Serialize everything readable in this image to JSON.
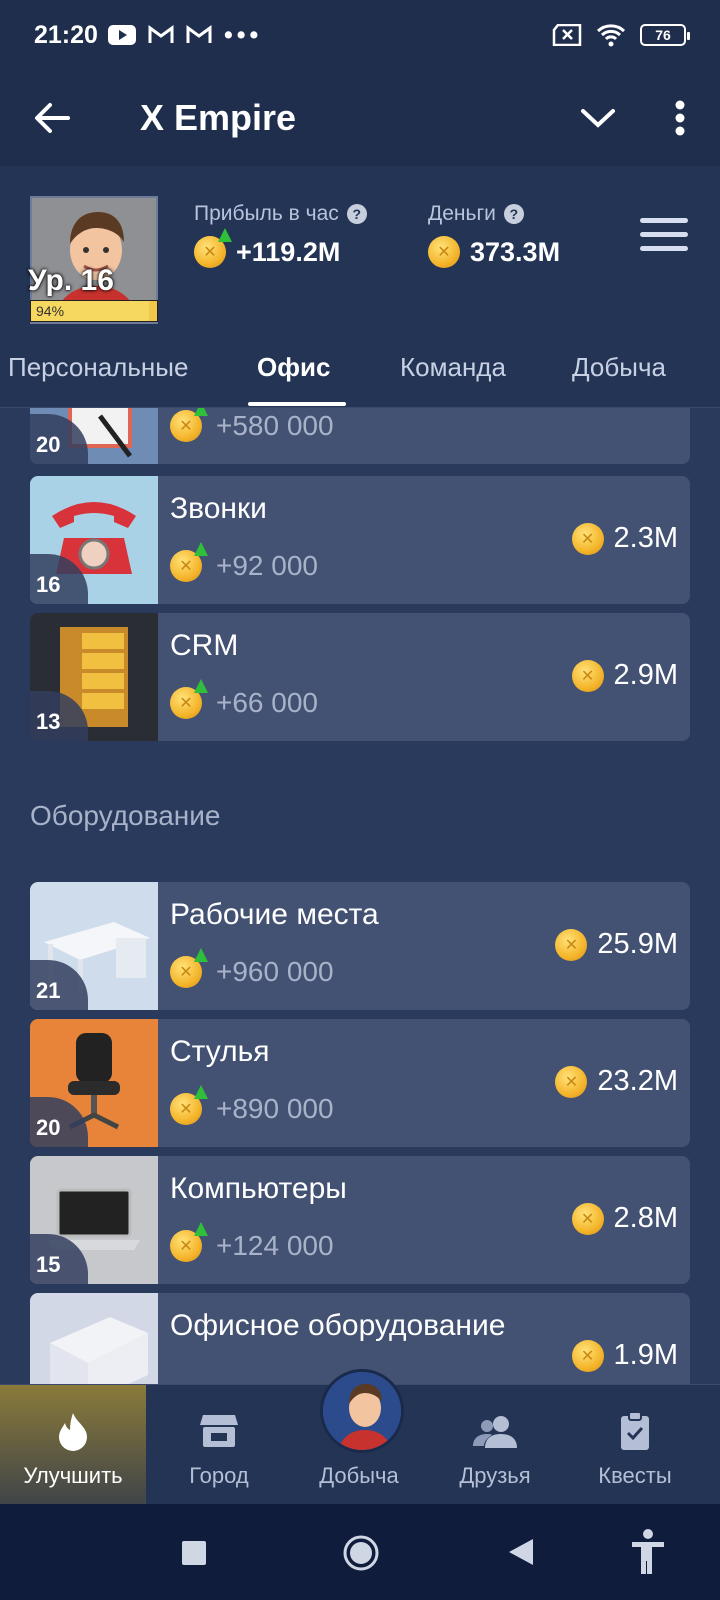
{
  "status_bar": {
    "time": "21:20",
    "battery": "76"
  },
  "app_bar": {
    "title": "X Empire"
  },
  "profile": {
    "level_label": "Ур. 16",
    "level_progress_label": "94%",
    "level_progress": 0.94,
    "profit_label": "Прибыль в час",
    "profit_value": "+119.2M",
    "money_label": "Деньги",
    "money_value": "373.3M",
    "help_glyph": "?"
  },
  "tabs": [
    {
      "label": "Персональные"
    },
    {
      "label": "Офис"
    },
    {
      "label": "Команда"
    },
    {
      "label": "Добыча"
    }
  ],
  "partial_top_card": {
    "level": "20",
    "profit": "+580 000"
  },
  "cards_group1": [
    {
      "name": "Звонки",
      "level": "16",
      "profit": "+92 000",
      "price": "2.3M"
    },
    {
      "name": "CRM",
      "level": "13",
      "profit": "+66 000",
      "price": "2.9M"
    }
  ],
  "section_equipment": "Оборудование",
  "cards_group2": [
    {
      "name": "Рабочие места",
      "level": "21",
      "profit": "+960 000",
      "price": "25.9M"
    },
    {
      "name": "Стулья",
      "level": "20",
      "profit": "+890 000",
      "price": "23.2M"
    },
    {
      "name": "Компьютеры",
      "level": "15",
      "profit": "+124 000",
      "price": "2.8M"
    },
    {
      "name": "Офисное оборудование",
      "level": "",
      "profit": "",
      "price": "1.9M"
    }
  ],
  "bottom_nav": [
    {
      "label": "Улучшить",
      "icon": "flame-icon"
    },
    {
      "label": "Город",
      "icon": "store-icon"
    },
    {
      "label": "Добыча",
      "icon": "avatar"
    },
    {
      "label": "Друзья",
      "icon": "friends-icon"
    },
    {
      "label": "Квесты",
      "icon": "clipboard-icon"
    }
  ]
}
